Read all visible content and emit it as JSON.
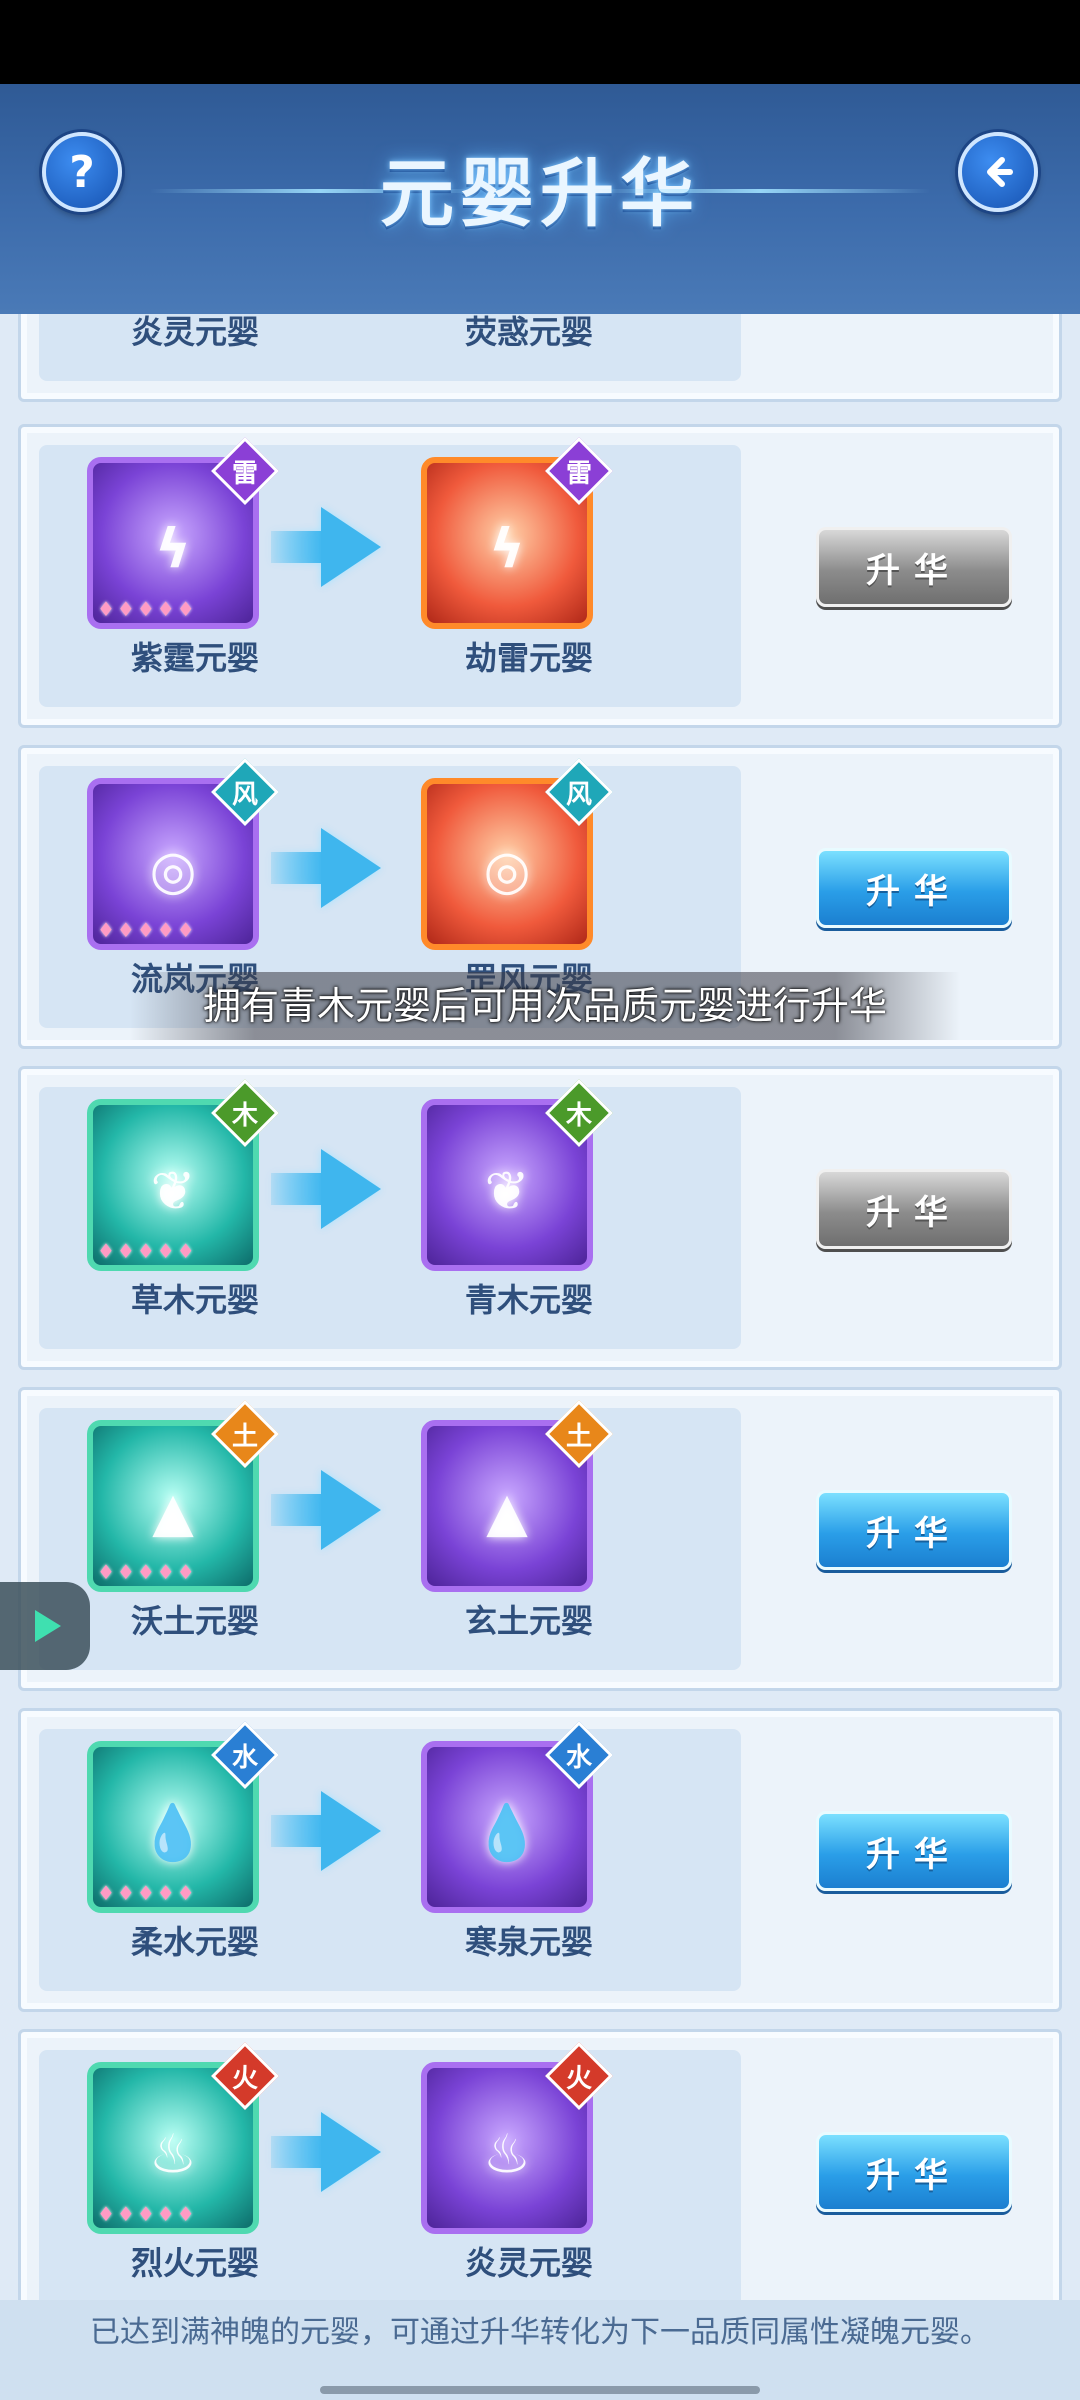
{
  "header": {
    "title": "元婴升华",
    "help_label": "?"
  },
  "partial_card": {
    "from_name": "炎灵元婴",
    "to_name": "荧惑元婴"
  },
  "cards": [
    {
      "from_name": "紫霆元婴",
      "to_name": "劫雷元婴",
      "element": "雷",
      "from_tier": "purple",
      "to_tier": "red",
      "button_label": "升华",
      "button_state": "disabled",
      "icon": "lightning-icon"
    },
    {
      "from_name": "流岚元婴",
      "to_name": "罡风元婴",
      "element": "风",
      "from_tier": "purple",
      "to_tier": "red",
      "button_label": "升华",
      "button_state": "enabled",
      "icon": "whirlwind-icon"
    },
    {
      "from_name": "草木元婴",
      "to_name": "青木元婴",
      "element": "木",
      "from_tier": "teal",
      "to_tier": "purple",
      "button_label": "升华",
      "button_state": "disabled",
      "icon": "leaf-icon"
    },
    {
      "from_name": "沃土元婴",
      "to_name": "玄土元婴",
      "element": "土",
      "from_tier": "teal",
      "to_tier": "purple",
      "button_label": "升华",
      "button_state": "enabled",
      "icon": "mountain-icon"
    },
    {
      "from_name": "柔水元婴",
      "to_name": "寒泉元婴",
      "element": "水",
      "from_tier": "teal",
      "to_tier": "purple",
      "button_label": "升华",
      "button_state": "enabled",
      "icon": "water-drop-icon"
    },
    {
      "from_name": "烈火元婴",
      "to_name": "炎灵元婴",
      "element": "火",
      "from_tier": "teal",
      "to_tier": "purple",
      "button_label": "升华",
      "button_state": "enabled",
      "icon": "flame-icon"
    }
  ],
  "element_colors": {
    "雷": "#8b3fd6",
    "风": "#1fa7b8",
    "木": "#4b9a2a",
    "土": "#e8871a",
    "水": "#2a7fd4",
    "火": "#d43a2a"
  },
  "toast": "拥有青木元婴后可用次品质元婴进行升华",
  "footer": "已达到满神魄的元婴，可通过升华转化为下一品质同属性凝魄元婴。"
}
